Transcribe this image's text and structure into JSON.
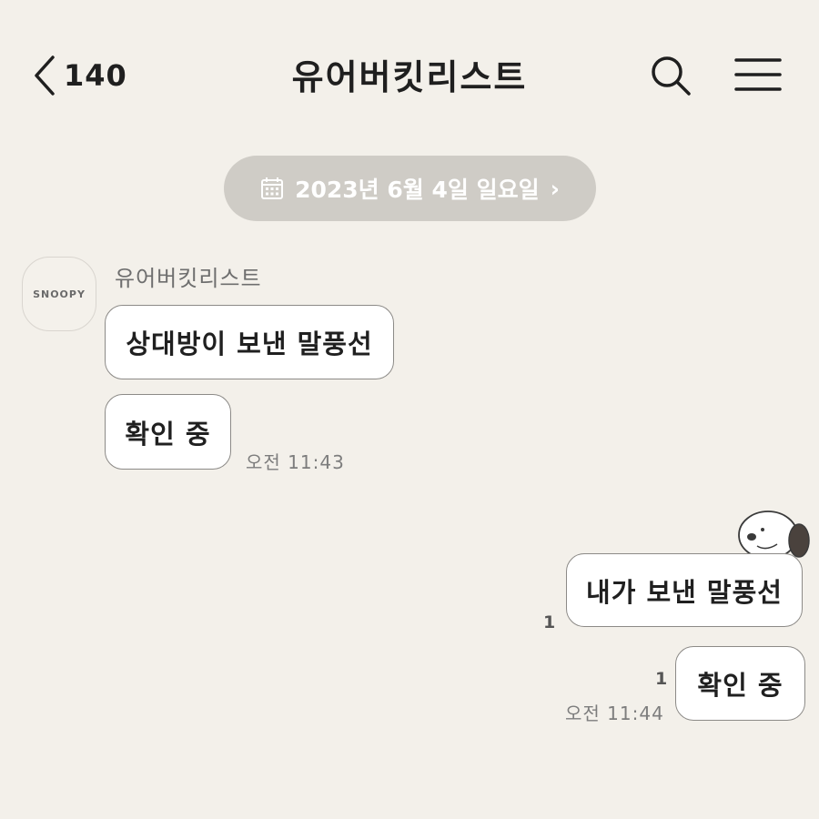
{
  "header": {
    "back_count": "140",
    "title": "유어버킷리스트",
    "back_icon": "chevron-left-icon",
    "search_icon": "search-icon",
    "menu_icon": "hamburger-menu-icon"
  },
  "date_divider": {
    "text": "2023년 6월 4일 일요일",
    "icon": "calendar-icon",
    "arrow": "›"
  },
  "received": {
    "avatar_text": "SNOOPY",
    "sender_name": "유어버킷리스트",
    "messages": [
      {
        "text": "상대방이 보낸 말풍선"
      },
      {
        "text": "확인 중"
      }
    ],
    "time": "오전 11:43"
  },
  "sent": {
    "messages": [
      {
        "text": "내가 보낸 말풍선",
        "unread": "1"
      },
      {
        "text": "확인 중",
        "unread": "1"
      }
    ],
    "time": "오전 11:44"
  },
  "colors": {
    "background": "#f3f0ea",
    "date_pill": "#cfccc6",
    "bubble": "#ffffff",
    "bubble_border": "#8c8a87"
  }
}
